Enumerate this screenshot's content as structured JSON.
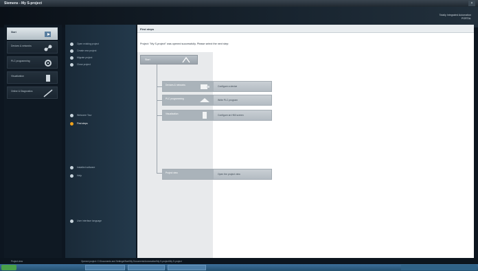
{
  "window": {
    "title": "Siemens - My S-project",
    "close_glyph": "×"
  },
  "brand": {
    "line1": "Totally Integrated Automation",
    "line2": "PORTAL"
  },
  "portal_tiles": [
    {
      "label": "Devices & networks",
      "icon": "devices-icon",
      "active": false
    },
    {
      "label": "PLC programming",
      "icon": "plc-programming-icon",
      "active": false
    },
    {
      "label": "Visualization",
      "icon": "visualization-icon",
      "active": false
    },
    {
      "label": "Online & Diagnostics",
      "icon": "online-diagnostics-icon",
      "active": false
    }
  ],
  "start_tile": {
    "label": "Start",
    "icon": "start-icon"
  },
  "nav": {
    "group1": [
      "Open existing project",
      "Create new project",
      "Migrate project",
      "Close project"
    ],
    "group2": [
      "Welcome Tour",
      "First steps"
    ],
    "group3": [
      "Installed software",
      "Help"
    ],
    "group4": [
      "User interface language"
    ],
    "selected": "First steps"
  },
  "content": {
    "heading": "First steps",
    "prompt": "Project: \"My S-project\" was opened successfully. Please select the next step:",
    "start_label": "Start",
    "steps": [
      {
        "label": "Devices & networks",
        "action": "Configure a device",
        "icon": "device-config-icon"
      },
      {
        "label": "PLC programming",
        "action": "Write PLC program",
        "icon": "plc-write-icon"
      },
      {
        "label": "Visualization",
        "action": "Configure an HMI screen",
        "icon": "hmi-screen-icon"
      },
      {
        "label": "Project view",
        "action": "Open the project view",
        "icon": "project-view-icon"
      }
    ]
  },
  "status": {
    "left": "Project view",
    "right": "Opened project: C:\\Documents and Settings\\Start\\My Documents\\Automation\\My S-project\\My S-project"
  }
}
